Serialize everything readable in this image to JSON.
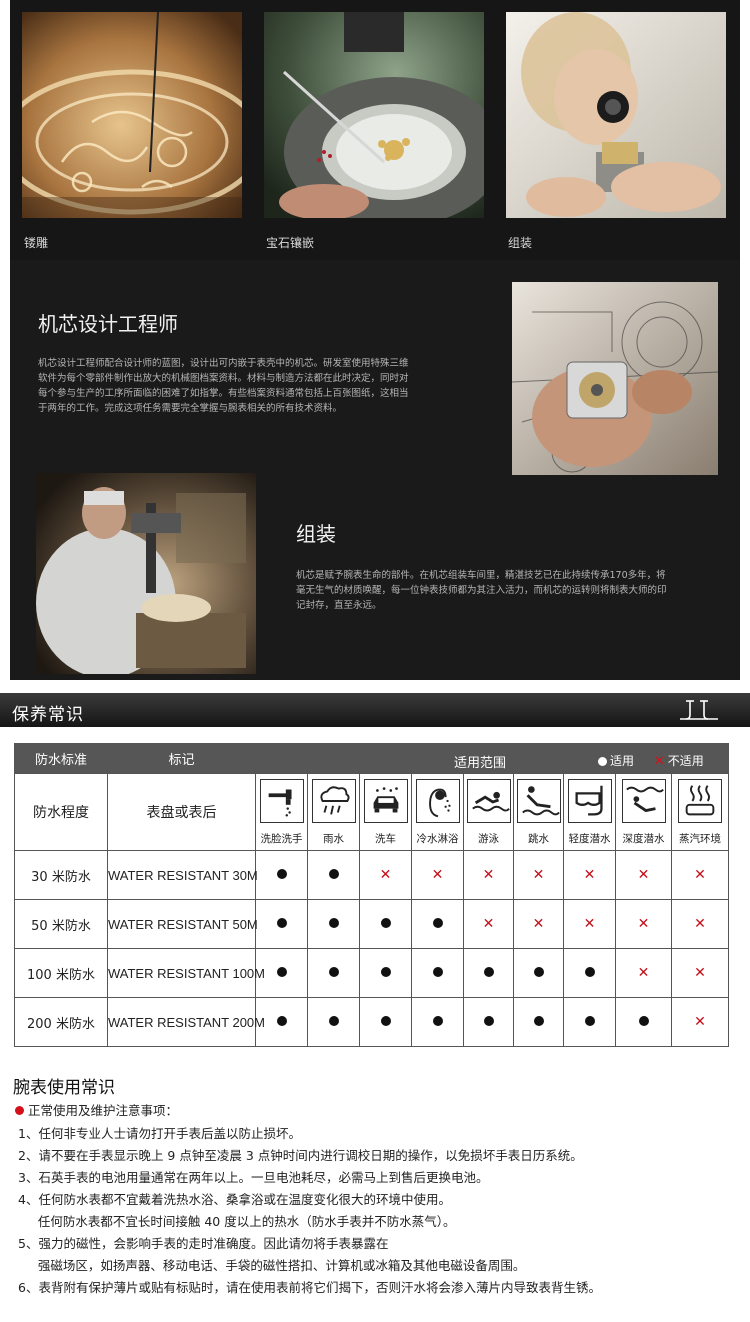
{
  "gallery": [
    {
      "caption": "镂雕"
    },
    {
      "caption": "宝石镶嵌"
    },
    {
      "caption": "组装"
    }
  ],
  "designer": {
    "title": "机芯设计工程师",
    "lines": [
      "机芯设计工程师配合设计师的蓝图，设计出可内嵌于表壳中的机芯。研发室使用特殊三维",
      "软件为每个零部件制作出放大的机械图档案资料。材料与制造方法都在此时决定，同时对",
      "每个参与生产的工序所面临的困难了如指掌。有些档案资料通常包括上百张图纸，这相当",
      "于两年的工作。完成这项任务需要完全掌握与腕表相关的所有技术资料。"
    ]
  },
  "assembly": {
    "title": "组装",
    "lines": [
      "机芯是赋予腕表生命的部件。在机芯组装车间里，精湛技艺已在此持续传承170多年，将",
      "毫无生气的材质唤醒，每一位钟表技师都为其注入活力，而机芯的运转则将制表大师的印",
      "记封存，直至永远。"
    ]
  },
  "care": {
    "title": "保养常识"
  },
  "wr_table": {
    "headers": {
      "standard": "防水标准",
      "marking": "标记",
      "scope": "适用范围"
    },
    "legend": {
      "yes": "适用",
      "no": "不适用"
    },
    "row_label": {
      "degree": "防水程度",
      "marking": "表盘或表后"
    },
    "activities": [
      {
        "label": "洗脸洗手",
        "icon": "faucet-icon"
      },
      {
        "label": "雨水",
        "icon": "rain-icon"
      },
      {
        "label": "洗车",
        "icon": "car-wash-icon"
      },
      {
        "label": "冷水淋浴",
        "icon": "shower-icon"
      },
      {
        "label": "游泳",
        "icon": "swimming-icon"
      },
      {
        "label": "跳水",
        "icon": "diving-icon"
      },
      {
        "label": "轻度潜水",
        "icon": "snorkel-icon"
      },
      {
        "label": "深度潜水",
        "icon": "deep-dive-icon"
      },
      {
        "label": "蒸汽环境",
        "icon": "steam-icon"
      }
    ],
    "rows": [
      {
        "level": "30 米防水",
        "marking": "WATER RESISTANT 30M",
        "suitable": [
          true,
          true,
          false,
          false,
          false,
          false,
          false,
          false,
          false
        ]
      },
      {
        "level": "50 米防水",
        "marking": "WATER RESISTANT 50M",
        "suitable": [
          true,
          true,
          true,
          true,
          false,
          false,
          false,
          false,
          false
        ]
      },
      {
        "level": "100 米防水",
        "marking": "WATER RESISTANT 100M",
        "suitable": [
          true,
          true,
          true,
          true,
          true,
          true,
          true,
          false,
          false
        ]
      },
      {
        "level": "200 米防水",
        "marking": "WATER RESISTANT 200M",
        "suitable": [
          true,
          true,
          true,
          true,
          true,
          true,
          true,
          true,
          false
        ]
      }
    ]
  },
  "usage": {
    "title": "腕表使用常识",
    "subtitle": "正常使用及维护注意事项：",
    "notes": [
      "1、任何非专业人士请勿打开手表后盖以防止损坏。",
      "2、请不要在手表显示晚上 9 点钟至凌晨 3 点钟时间内进行调校日期的操作，以免损坏手表日历系统。",
      "3、石英手表的电池用量通常在两年以上。一旦电池耗尽，必需马上到售后更换电池。",
      "4、任何防水表都不宜戴着洗热水浴、桑拿浴或在温度变化很大的环境中使用。",
      "     任何防水表都不宜长时间接触 40 度以上的热水（防水手表并不防水蒸气）。",
      "5、强力的磁性，会影响手表的走时准确度。因此请勿将手表暴露在",
      "     强磁场区，如扬声器、移动电话、手袋的磁性搭扣、计算机或冰箱及其他电磁设备周围。",
      "6、表背附有保护薄片或贴有标贴时，请在使用表前将它们揭下，否则汗水将会渗入薄片内导致表背生锈。"
    ]
  }
}
